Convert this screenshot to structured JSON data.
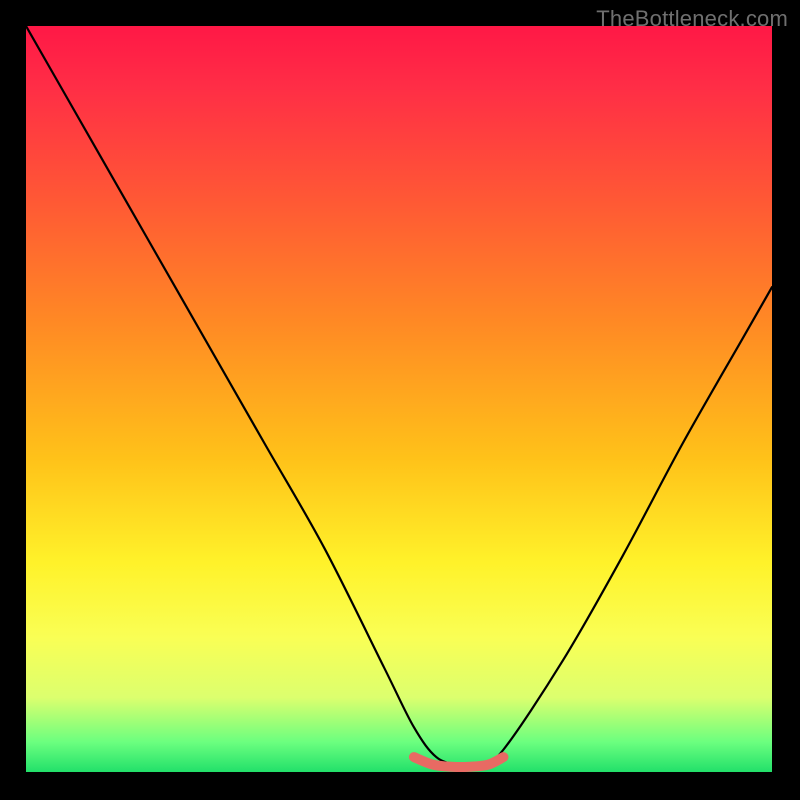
{
  "watermark": "TheBottleneck.com",
  "colors": {
    "frame": "#000000",
    "curve": "#000000",
    "highlight": "#e86a63"
  },
  "chart_data": {
    "type": "line",
    "title": "",
    "xlabel": "",
    "ylabel": "",
    "xlim": [
      0,
      100
    ],
    "ylim": [
      0,
      100
    ],
    "grid": false,
    "series": [
      {
        "name": "bottleneck-curve",
        "x": [
          0,
          8,
          16,
          24,
          32,
          40,
          48,
          52,
          55,
          58,
          61,
          64,
          72,
          80,
          88,
          96,
          100
        ],
        "y": [
          100,
          86,
          72,
          58,
          44,
          30,
          14,
          6,
          2,
          1,
          1,
          3,
          15,
          29,
          44,
          58,
          65
        ]
      },
      {
        "name": "valley-highlight",
        "x": [
          52,
          54.5,
          57,
          59.5,
          62,
          64
        ],
        "y": [
          2.0,
          1.0,
          0.7,
          0.7,
          1.0,
          2.0
        ]
      }
    ],
    "annotations": []
  }
}
